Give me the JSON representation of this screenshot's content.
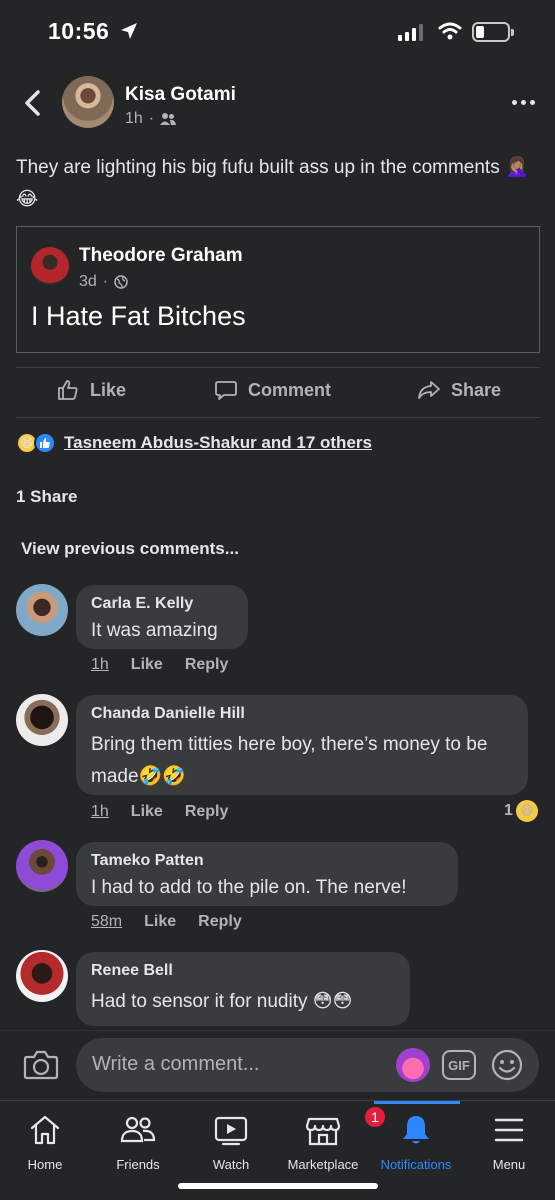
{
  "status_bar": {
    "time": "10:56"
  },
  "post": {
    "author": "Kisa Gotami",
    "time": "1h",
    "privacy_icon": "friends-icon",
    "text": "They are lighting his big fufu built ass up in the comments 🤦🏽‍♀️😂",
    "shared": {
      "author": "Theodore Graham",
      "time": "3d",
      "privacy_icon": "globe-icon",
      "text": "I Hate Fat Bitches"
    },
    "actions": {
      "like": "Like",
      "comment": "Comment",
      "share": "Share"
    },
    "reactions": {
      "icons": [
        "haha-icon",
        "like-icon"
      ],
      "text": "Tasneem Abdus-Shakur and 17 others"
    },
    "share_count": "1 Share"
  },
  "view_previous": "View previous comments...",
  "comments": [
    {
      "name": "Carla E. Kelly",
      "text": "It was amazing",
      "time": "1h",
      "like": "Like",
      "reply": "Reply"
    },
    {
      "name": "Chanda Danielle Hill",
      "text": "Bring them titties here boy, there’s money to be made🤣🤣",
      "time": "1h",
      "like": "Like",
      "reply": "Reply",
      "reaction_count": "1"
    },
    {
      "name": "Tameko Patten",
      "text": "I had to add to the pile on. The nerve!",
      "time": "58m",
      "like": "Like",
      "reply": "Reply"
    },
    {
      "name": "Renee Bell",
      "text": "Had to sensor it for nudity 😳😳"
    }
  ],
  "composer": {
    "placeholder": "Write a comment...",
    "gif": "GIF"
  },
  "tabs": [
    {
      "label": "Home",
      "icon": "home-icon"
    },
    {
      "label": "Friends",
      "icon": "friends-icon"
    },
    {
      "label": "Watch",
      "icon": "watch-icon"
    },
    {
      "label": "Marketplace",
      "icon": "marketplace-icon",
      "badge": "1"
    },
    {
      "label": "Notifications",
      "icon": "bell-icon",
      "active": true
    },
    {
      "label": "Menu",
      "icon": "menu-icon"
    }
  ],
  "colors": {
    "background": "#242526",
    "bubble": "#3a3b3c",
    "accent": "#2d88ff",
    "badge": "#e41e3f"
  }
}
